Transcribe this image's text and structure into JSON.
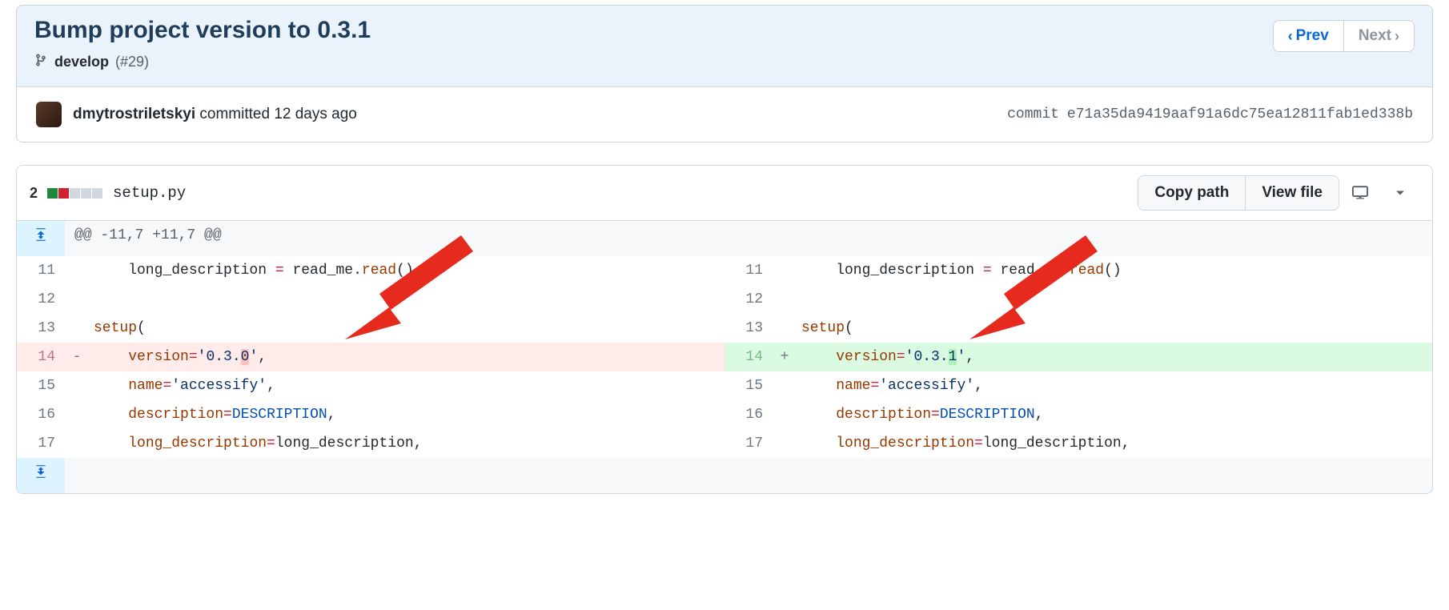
{
  "commit": {
    "title": "Bump project version to 0.3.1",
    "branch_name": "develop",
    "pr_ref": "(#29)",
    "author": "dmytrostriletskyi",
    "committed_text": "committed 12 days ago",
    "hash_label": "commit",
    "hash": "e71a35da9419aaf91a6dc75ea12811fab1ed338b",
    "nav": {
      "prev": "Prev",
      "next": "Next"
    }
  },
  "file": {
    "change_count": "2",
    "squares": [
      "g",
      "r",
      "n",
      "n",
      "n"
    ],
    "name": "setup.py",
    "buttons": {
      "copy": "Copy path",
      "view": "View file"
    },
    "hunk_header": "@@ -11,7 +11,7 @@"
  },
  "diff": {
    "left": [
      {
        "ln": "11",
        "mark": " ",
        "cls": "",
        "segments": [
          {
            "t": "    long_description ",
            "c": ""
          },
          {
            "t": "=",
            "c": "tok-kw"
          },
          {
            "t": " read_me",
            "c": ""
          },
          {
            "t": ".",
            "c": ""
          },
          {
            "t": "read",
            "c": "tok-fn"
          },
          {
            "t": "()",
            "c": ""
          }
        ]
      },
      {
        "ln": "12",
        "mark": " ",
        "cls": "",
        "segments": [
          {
            "t": "",
            "c": ""
          }
        ]
      },
      {
        "ln": "13",
        "mark": " ",
        "cls": "",
        "segments": [
          {
            "t": "setup",
            "c": "tok-fn"
          },
          {
            "t": "(",
            "c": ""
          }
        ]
      },
      {
        "ln": "14",
        "mark": "-",
        "cls": "del",
        "segments": [
          {
            "t": "    ",
            "c": ""
          },
          {
            "t": "version",
            "c": "tok-fn"
          },
          {
            "t": "=",
            "c": "tok-kw"
          },
          {
            "t": "'0.3.",
            "c": "tok-str"
          },
          {
            "t": "0",
            "c": "tok-str char-del"
          },
          {
            "t": "'",
            "c": "tok-str"
          },
          {
            "t": ",",
            "c": ""
          }
        ]
      },
      {
        "ln": "15",
        "mark": " ",
        "cls": "",
        "segments": [
          {
            "t": "    ",
            "c": ""
          },
          {
            "t": "name",
            "c": "tok-fn"
          },
          {
            "t": "=",
            "c": "tok-kw"
          },
          {
            "t": "'accessify'",
            "c": "tok-str"
          },
          {
            "t": ",",
            "c": ""
          }
        ]
      },
      {
        "ln": "16",
        "mark": " ",
        "cls": "",
        "segments": [
          {
            "t": "    ",
            "c": ""
          },
          {
            "t": "description",
            "c": "tok-fn"
          },
          {
            "t": "=",
            "c": "tok-kw"
          },
          {
            "t": "DESCRIPTION",
            "c": "tok-const"
          },
          {
            "t": ",",
            "c": ""
          }
        ]
      },
      {
        "ln": "17",
        "mark": " ",
        "cls": "",
        "segments": [
          {
            "t": "    ",
            "c": ""
          },
          {
            "t": "long_description",
            "c": "tok-fn"
          },
          {
            "t": "=",
            "c": "tok-kw"
          },
          {
            "t": "long_description,",
            "c": ""
          }
        ]
      }
    ],
    "right": [
      {
        "ln": "11",
        "mark": " ",
        "cls": "",
        "segments": [
          {
            "t": "    long_description ",
            "c": ""
          },
          {
            "t": "=",
            "c": "tok-kw"
          },
          {
            "t": " read_me",
            "c": ""
          },
          {
            "t": ".",
            "c": ""
          },
          {
            "t": "read",
            "c": "tok-fn"
          },
          {
            "t": "()",
            "c": ""
          }
        ]
      },
      {
        "ln": "12",
        "mark": " ",
        "cls": "",
        "segments": [
          {
            "t": "",
            "c": ""
          }
        ]
      },
      {
        "ln": "13",
        "mark": " ",
        "cls": "",
        "segments": [
          {
            "t": "setup",
            "c": "tok-fn"
          },
          {
            "t": "(",
            "c": ""
          }
        ]
      },
      {
        "ln": "14",
        "mark": "+",
        "cls": "add",
        "segments": [
          {
            "t": "    ",
            "c": ""
          },
          {
            "t": "version",
            "c": "tok-fn"
          },
          {
            "t": "=",
            "c": "tok-kw"
          },
          {
            "t": "'0.3.",
            "c": "tok-str"
          },
          {
            "t": "1",
            "c": "tok-str char-add"
          },
          {
            "t": "'",
            "c": "tok-str"
          },
          {
            "t": ",",
            "c": ""
          }
        ]
      },
      {
        "ln": "15",
        "mark": " ",
        "cls": "",
        "segments": [
          {
            "t": "    ",
            "c": ""
          },
          {
            "t": "name",
            "c": "tok-fn"
          },
          {
            "t": "=",
            "c": "tok-kw"
          },
          {
            "t": "'accessify'",
            "c": "tok-str"
          },
          {
            "t": ",",
            "c": ""
          }
        ]
      },
      {
        "ln": "16",
        "mark": " ",
        "cls": "",
        "segments": [
          {
            "t": "    ",
            "c": ""
          },
          {
            "t": "description",
            "c": "tok-fn"
          },
          {
            "t": "=",
            "c": "tok-kw"
          },
          {
            "t": "DESCRIPTION",
            "c": "tok-const"
          },
          {
            "t": ",",
            "c": ""
          }
        ]
      },
      {
        "ln": "17",
        "mark": " ",
        "cls": "",
        "segments": [
          {
            "t": "    ",
            "c": ""
          },
          {
            "t": "long_description",
            "c": "tok-fn"
          },
          {
            "t": "=",
            "c": "tok-kw"
          },
          {
            "t": "long_description,",
            "c": ""
          }
        ]
      }
    ]
  }
}
